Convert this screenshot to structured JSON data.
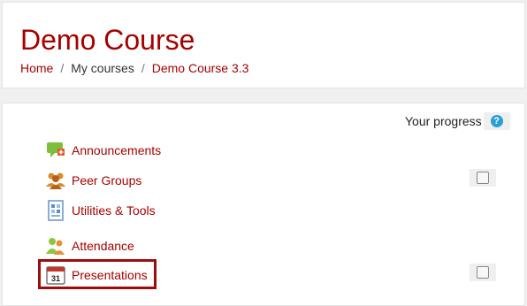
{
  "header": {
    "course_title": "Demo Course",
    "breadcrumb": [
      {
        "label": "Home"
      },
      {
        "label": "My courses"
      },
      {
        "label": "Demo Course 3.3"
      }
    ],
    "separator": "/"
  },
  "progress": {
    "label": "Your progress",
    "help_glyph": "?"
  },
  "activities": [
    {
      "label": "Announcements",
      "icon": "forum-icon",
      "has_checkbox": false
    },
    {
      "label": "Peer Groups",
      "icon": "group-icon",
      "has_checkbox": true,
      "checked": false
    },
    {
      "label": "Utilities & Tools",
      "icon": "page-icon",
      "has_checkbox": false
    },
    {
      "label": "Attendance",
      "icon": "attendance-icon",
      "has_checkbox": false
    },
    {
      "label": "Presentations",
      "icon": "calendar-icon",
      "icon_text": "31",
      "has_checkbox": true,
      "checked": false
    }
  ],
  "colors": {
    "link": "#a60000",
    "highlight_border": "#9e0c0c",
    "help_icon": "#2a9fd6"
  }
}
